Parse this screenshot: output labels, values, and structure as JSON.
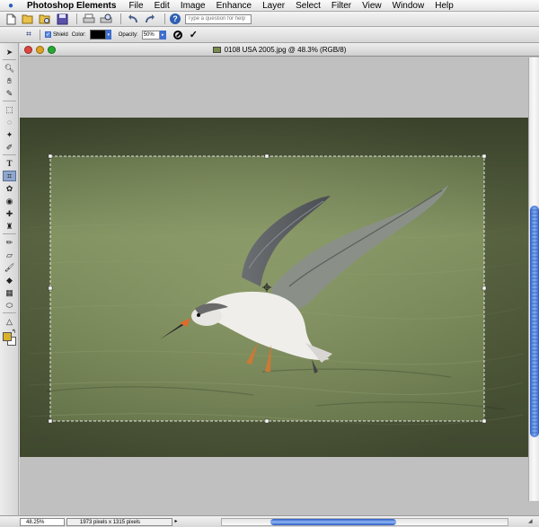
{
  "menubar": {
    "app_name": "Photoshop Elements",
    "items": [
      "File",
      "Edit",
      "Image",
      "Enhance",
      "Layer",
      "Select",
      "Filter",
      "View",
      "Window",
      "Help"
    ]
  },
  "shortcuts": {
    "help_placeholder": "Type a question for help"
  },
  "options": {
    "shield_label": "Shield",
    "color_label": "Color:",
    "opacity_label": "Opacity:",
    "opacity_value": "50%",
    "color_value": "#000000"
  },
  "document": {
    "title": "0108 USA 2005.jpg @ 48.3% (RGB/8)"
  },
  "status": {
    "zoom": "48.25%",
    "dimensions": "1973 pixels x 1315 pixels"
  },
  "colors": {
    "foreground": "#d9b22a",
    "background": "#ffffff",
    "water": "#7d8c5e"
  }
}
